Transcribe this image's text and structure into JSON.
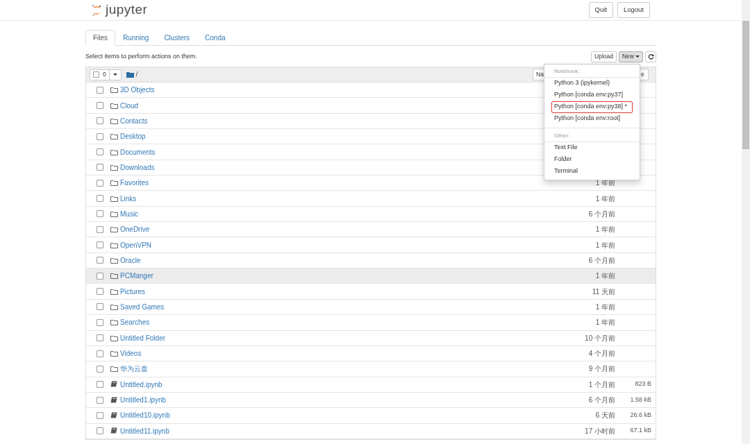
{
  "header": {
    "logo_text": "jupyter",
    "buttons": [
      "Quit",
      "Logout"
    ]
  },
  "tabs": [
    {
      "label": "Files",
      "selected": true
    },
    {
      "label": "Running",
      "selected": false
    },
    {
      "label": "Clusters",
      "selected": false
    },
    {
      "label": "Conda",
      "selected": false
    }
  ],
  "toolbar": {
    "hint": "Select items to perform actions on them.",
    "upload": "Upload",
    "new": "New",
    "new_expanded": true
  },
  "list_header": {
    "selected_count": "0",
    "path": "/",
    "all_checked": false,
    "sort_name_visible": "Na",
    "sort_size_visible": "e"
  },
  "rows": [
    {
      "kind": "folder",
      "name": "3D Objects",
      "checked": false,
      "hovered": false
    },
    {
      "kind": "folder",
      "name": "Cloud",
      "checked": false,
      "hovered": false
    },
    {
      "kind": "folder",
      "name": "Contacts",
      "checked": false,
      "hovered": false
    },
    {
      "kind": "folder",
      "name": "Desktop",
      "checked": false,
      "hovered": false
    },
    {
      "kind": "folder",
      "name": "Documents",
      "checked": false,
      "hovered": false
    },
    {
      "kind": "folder",
      "name": "Downloads",
      "checked": false,
      "hovered": false
    },
    {
      "kind": "folder",
      "name": "Favorites",
      "modified": "1 年前",
      "checked": false,
      "hovered": false
    },
    {
      "kind": "folder",
      "name": "Links",
      "modified": "1 年前",
      "checked": false,
      "hovered": false
    },
    {
      "kind": "folder",
      "name": "Music",
      "modified": "6 个月前",
      "checked": false,
      "hovered": false
    },
    {
      "kind": "folder",
      "name": "OneDrive",
      "modified": "1 年前",
      "checked": false,
      "hovered": false
    },
    {
      "kind": "folder",
      "name": "OpenVPN",
      "modified": "1 年前",
      "checked": false,
      "hovered": false
    },
    {
      "kind": "folder",
      "name": "Oracle",
      "modified": "6 个月前",
      "checked": false,
      "hovered": false
    },
    {
      "kind": "folder",
      "name": "PCManger",
      "modified": "1 年前",
      "checked": false,
      "hovered": true
    },
    {
      "kind": "folder",
      "name": "Pictures",
      "modified": "11 天前",
      "checked": false,
      "hovered": false
    },
    {
      "kind": "folder",
      "name": "Saved Games",
      "modified": "1 年前",
      "checked": false,
      "hovered": false
    },
    {
      "kind": "folder",
      "name": "Searches",
      "modified": "1 年前",
      "checked": false,
      "hovered": false
    },
    {
      "kind": "folder",
      "name": "Untitled Folder",
      "modified": "10 个月前",
      "checked": false,
      "hovered": false
    },
    {
      "kind": "folder",
      "name": "Videos",
      "modified": "4 个月前",
      "checked": false,
      "hovered": false
    },
    {
      "kind": "folder",
      "name": "华为云盘",
      "modified": "9 个月前",
      "checked": false,
      "hovered": false
    },
    {
      "kind": "notebook",
      "name": "Untitled.ipynb",
      "modified": "1 个月前",
      "size": "823 B",
      "checked": false,
      "hovered": false
    },
    {
      "kind": "notebook",
      "name": "Untitled1.ipynb",
      "modified": "6 个月前",
      "size": "1.58 kB",
      "checked": false,
      "hovered": false
    },
    {
      "kind": "notebook",
      "name": "Untitled10.ipynb",
      "modified": "6 天前",
      "size": "26.6 kB",
      "checked": false,
      "hovered": false
    },
    {
      "kind": "notebook",
      "name": "Untitled11.ipynb",
      "modified": "17 小时前",
      "size": "67.1 kB",
      "checked": false,
      "hovered": false
    }
  ],
  "new_menu": [
    {
      "kind": "section",
      "label": "Notebook:"
    },
    {
      "kind": "item",
      "label": "Python 3 (ipykernel)",
      "outlined": false
    },
    {
      "kind": "item",
      "label": "Python [conda env:py37]",
      "outlined": false
    },
    {
      "kind": "item",
      "label": "Python [conda env:py38] *",
      "outlined": true
    },
    {
      "kind": "item",
      "label": "Python [conda env:root]",
      "outlined": false
    },
    {
      "kind": "section",
      "label": "Other:"
    },
    {
      "kind": "item",
      "label": "Text File",
      "outlined": false
    },
    {
      "kind": "item",
      "label": "Folder",
      "outlined": false
    },
    {
      "kind": "item",
      "label": "Terminal",
      "outlined": false
    }
  ]
}
